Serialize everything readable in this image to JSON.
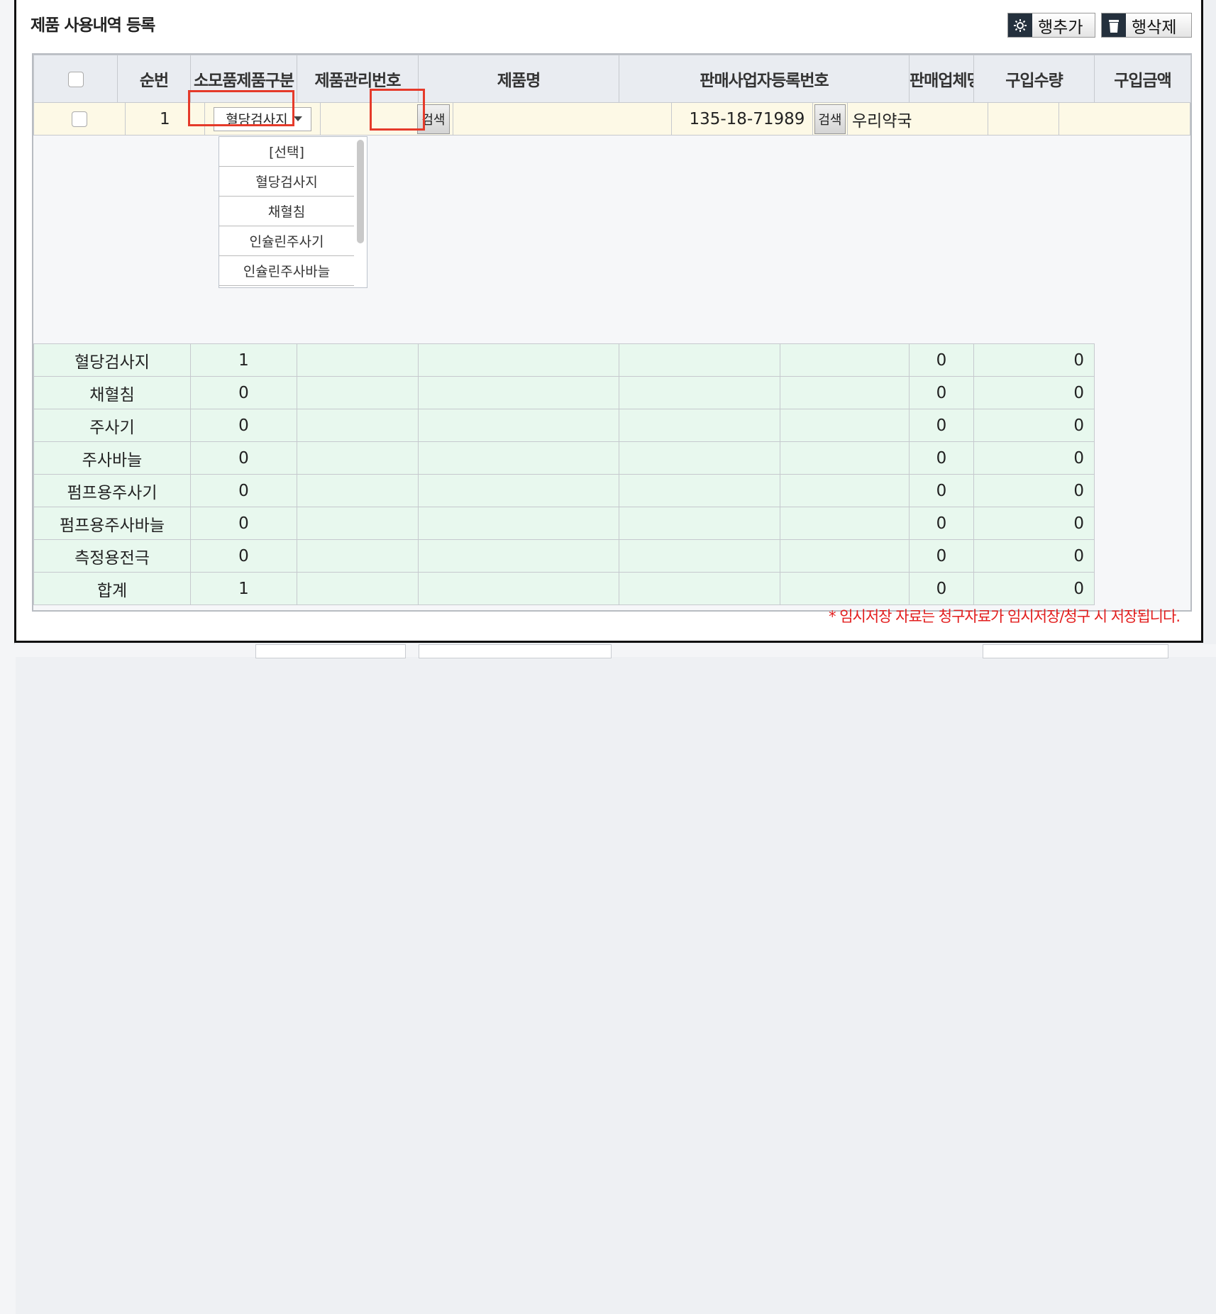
{
  "modal": {
    "title": "제품 사용내역 등록",
    "add_row_label": "행추가",
    "delete_row_label": "행삭제",
    "note": "* 임시저장 자료는 청구자료가 임시저장/청구 시 저장됩니다."
  },
  "columns": [
    "순번",
    "소모품제품구분",
    "제품관리번호",
    "제품명",
    "판매사업자등록번호",
    "판매업체명",
    "구입수량",
    "구입금액"
  ],
  "row": {
    "seq": "1",
    "category": "혈당검사지",
    "product_mgmt_no": "",
    "search_label": "검색",
    "product_name": "",
    "seller_reg_no": "135-18-71989",
    "seller_search_label": "검색",
    "seller_name": "우리약국",
    "quantity": "",
    "amount": ""
  },
  "dropdown_options": [
    "[선택]",
    "혈당검사지",
    "채혈침",
    "인슐린주사기",
    "인슐린주사바늘"
  ],
  "summary": [
    {
      "label": "혈당검사지",
      "count": "1",
      "qty": "0",
      "amount": "0"
    },
    {
      "label": "채혈침",
      "count": "0",
      "qty": "0",
      "amount": "0"
    },
    {
      "label": "주사기",
      "count": "0",
      "qty": "0",
      "amount": "0"
    },
    {
      "label": "주사바늘",
      "count": "0",
      "qty": "0",
      "amount": "0"
    },
    {
      "label": "펌프용주사기",
      "count": "0",
      "qty": "0",
      "amount": "0"
    },
    {
      "label": "펌프용주사바늘",
      "count": "0",
      "qty": "0",
      "amount": "0"
    },
    {
      "label": "측정용전극",
      "count": "0",
      "qty": "0",
      "amount": "0"
    },
    {
      "label": "합계",
      "count": "1",
      "qty": "0",
      "amount": "0"
    }
  ],
  "colors": {
    "highlight": "#e53a2a",
    "note": "#e21d1d",
    "summary_bg": "#e8f8ee",
    "row_bg": "#fdf9e6"
  }
}
